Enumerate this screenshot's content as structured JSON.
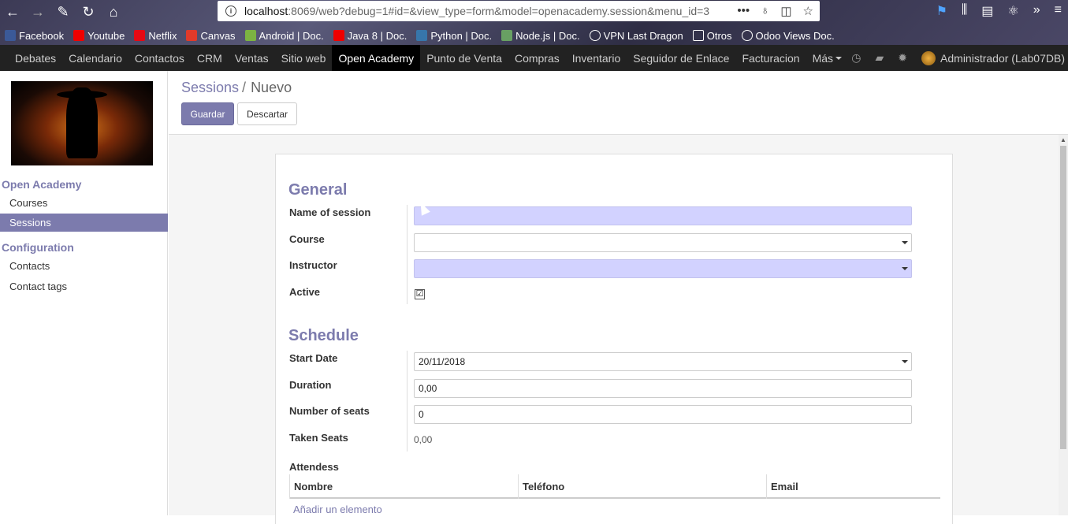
{
  "browser": {
    "url_host": "localhost",
    "url_rest": ":8069/web?debug=1#id=&view_type=form&model=openacademy.session&menu_id=3",
    "bookmarks": [
      {
        "label": "Facebook",
        "icon": "facebook-icon",
        "color": "#3b5998"
      },
      {
        "label": "Youtube",
        "icon": "youtube-icon",
        "color": "#e00"
      },
      {
        "label": "Netflix",
        "icon": "netflix-icon",
        "color": "#e50914"
      },
      {
        "label": "Canvas",
        "icon": "canvas-icon",
        "color": "#e13a2a"
      },
      {
        "label": "Android | Doc.",
        "icon": "android-icon",
        "color": "#7cb342"
      },
      {
        "label": "Java 8 | Doc.",
        "icon": "java-icon",
        "color": "#e00"
      },
      {
        "label": "Python | Doc.",
        "icon": "python-icon",
        "color": "#3776ab"
      },
      {
        "label": "Node.js |  Doc.",
        "icon": "nodejs-icon",
        "color": "#68a063"
      },
      {
        "label": "VPN Last Dragon",
        "icon": "globe-icon",
        "color": "#ffffff"
      },
      {
        "label": "Otros",
        "icon": "folder-icon",
        "color": "#ffffff"
      },
      {
        "label": "Odoo Views Doc.",
        "icon": "globe-icon",
        "color": "#ffffff"
      }
    ]
  },
  "appnav": {
    "items": [
      "Debates",
      "Calendario",
      "Contactos",
      "CRM",
      "Ventas",
      "Sitio web",
      "Open Academy",
      "Punto de Venta",
      "Compras",
      "Inventario",
      "Seguidor de Enlace",
      "Facturacion",
      "Más"
    ],
    "active_index": 6,
    "user": "Administrador (Lab07DB)"
  },
  "sidebar": {
    "sections": [
      {
        "title": "Open Academy",
        "items": [
          "Courses",
          "Sessions"
        ]
      },
      {
        "title": "Configuration",
        "items": [
          "Contacts",
          "Contact tags"
        ]
      }
    ],
    "active_item": "Sessions"
  },
  "breadcrumb": {
    "parent": "Sessions",
    "separator": "/",
    "current": "Nuevo"
  },
  "buttons": {
    "save": "Guardar",
    "discard": "Descartar"
  },
  "form": {
    "general_title": "General",
    "schedule_title": "Schedule",
    "fields": {
      "name_label": "Name of session",
      "name_value": "",
      "course_label": "Course",
      "course_value": "",
      "instructor_label": "Instructor",
      "instructor_value": "",
      "active_label": "Active",
      "active_value": "☑",
      "start_label": "Start Date",
      "start_value": "20/11/2018",
      "duration_label": "Duration",
      "duration_value": "0,00",
      "seats_label": "Number of seats",
      "seats_value": "0",
      "taken_label": "Taken Seats",
      "taken_value": "0,00"
    },
    "attendees_label": "Attendess",
    "attendees_columns": [
      "Nombre",
      "Teléfono",
      "Email"
    ],
    "add_line": "Añadir un elemento"
  },
  "colors": {
    "accent": "#7c7bad",
    "required_bg": "#d2d2ff",
    "nav_bg": "#222222"
  }
}
